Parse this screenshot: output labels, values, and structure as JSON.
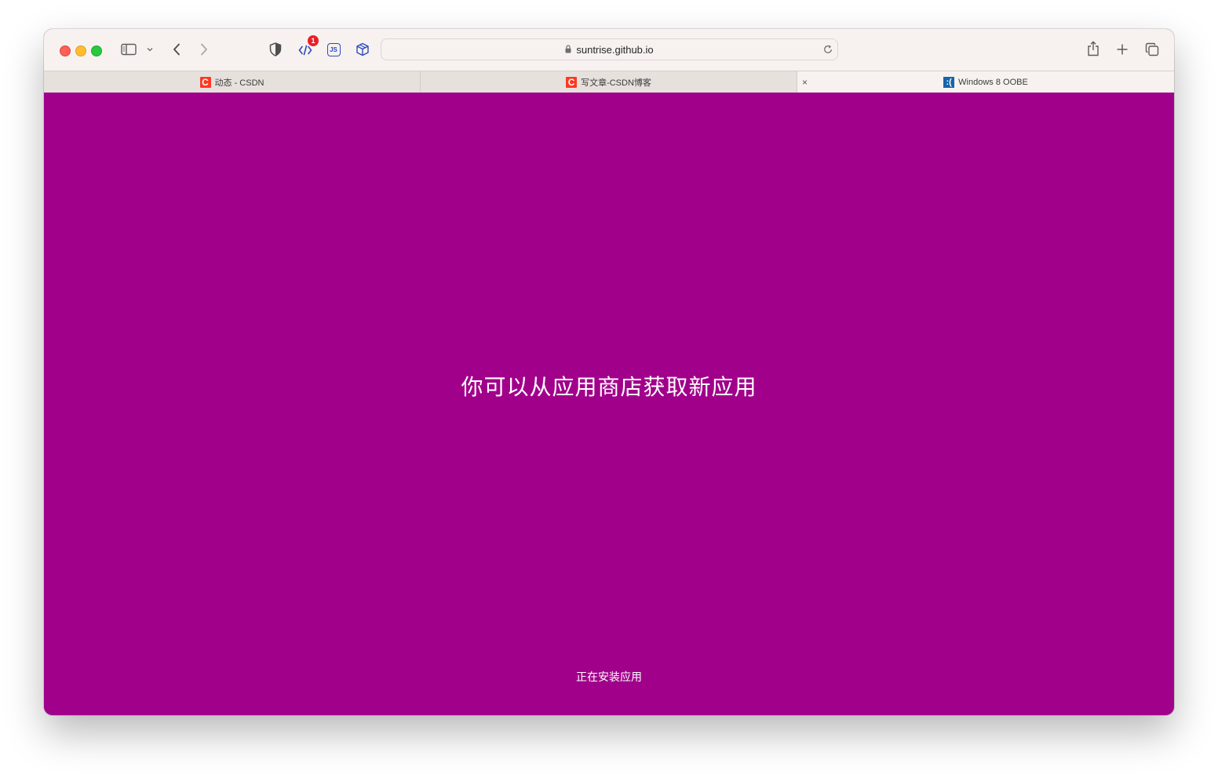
{
  "browser": {
    "url": "suntrise.github.io",
    "extension_badge_count": "1",
    "js_extension_label": "JS",
    "tabs": [
      {
        "title": "动态 - CSDN",
        "favicon": "csdn-icon",
        "favicon_letter": "C"
      },
      {
        "title": "写文章-CSDN博客",
        "favicon": "csdn-icon",
        "favicon_letter": "C"
      },
      {
        "title": "Windows 8 OOBE",
        "favicon": "windows8-oobe-icon",
        "favicon_letter": ":(",
        "active": true,
        "close_glyph": "×"
      }
    ],
    "toolbar_icons": [
      "sidebar-icon",
      "chevron-down-icon",
      "back-icon",
      "forward-icon",
      "shield-icon",
      "code-extension-icon",
      "js-extension-icon",
      "cube-extension-icon",
      "lock-icon",
      "reload-icon",
      "share-icon",
      "new-tab-icon",
      "tab-overview-icon"
    ]
  },
  "page": {
    "main_message": "你可以从应用商店获取新应用",
    "status_message": "正在安装应用",
    "background_color": "#a1008b",
    "text_color": "#ffffff"
  },
  "colors": {
    "close": "#fe5f57",
    "minimize": "#febc2e",
    "maximize": "#28c840",
    "csdn_red": "#fc3a22",
    "badge_red": "#e8202a"
  }
}
